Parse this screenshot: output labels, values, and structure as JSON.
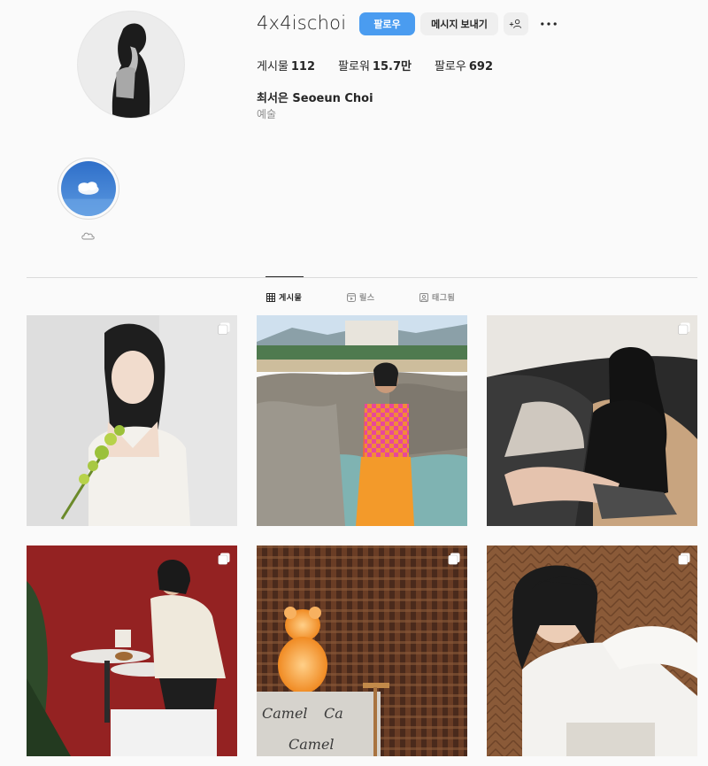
{
  "profile": {
    "username": "4x4ischoi",
    "full_name": "최서은 Seoeun Choi",
    "category": "예술",
    "avatar_icon": "profile-photo"
  },
  "actions": {
    "follow_label": "팔로우",
    "message_label": "메시지 보내기",
    "add_user_label": "+⁨⁩",
    "more_icon": "more-horizontal-icon"
  },
  "stats": {
    "posts_label": "게시물",
    "posts_value": "112",
    "followers_label": "팔로워",
    "followers_value": "15.7만",
    "following_label": "팔로우",
    "following_value": "692"
  },
  "highlights": [
    {
      "icon": "cloud-icon",
      "label": "☁︎"
    }
  ],
  "tabs": [
    {
      "label": "게시물",
      "icon": "grid-icon",
      "active": true
    },
    {
      "label": "릴스",
      "icon": "reels-icon",
      "active": false
    },
    {
      "label": "태그됨",
      "icon": "tagged-icon",
      "active": false
    }
  ],
  "posts": [
    {
      "name": "post-1",
      "multi": true
    },
    {
      "name": "post-2",
      "multi": false
    },
    {
      "name": "post-3",
      "multi": true
    },
    {
      "name": "post-4",
      "multi": true
    },
    {
      "name": "post-5",
      "multi": true
    },
    {
      "name": "post-6",
      "multi": true
    }
  ],
  "colors": {
    "accent": "#4a9cf0",
    "button_gray": "#efefef",
    "background": "#fafafa",
    "text": "#262626",
    "muted": "#8e8e8e"
  }
}
